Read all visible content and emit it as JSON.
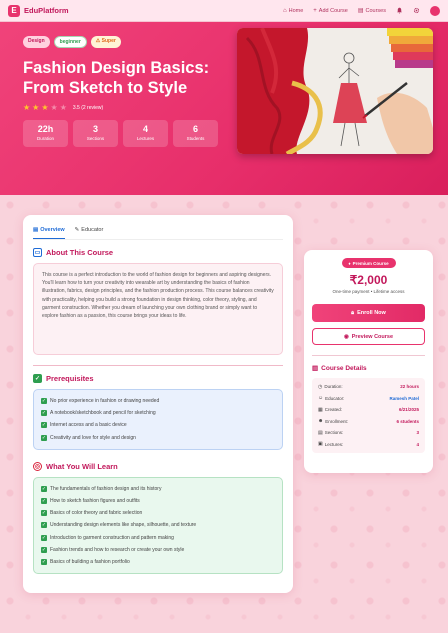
{
  "nav": {
    "brand": "EduPlatform",
    "links": [
      {
        "icon": "home-icon",
        "glyph": "⌂",
        "label": "Home"
      },
      {
        "icon": "plus-icon",
        "glyph": "+",
        "label": "Add Course"
      },
      {
        "icon": "book-icon",
        "glyph": "▤",
        "label": "Courses"
      }
    ],
    "bell_icon": "bell-icon",
    "settings_icon": "gear-icon"
  },
  "hero": {
    "tags": [
      "Design",
      "beginner",
      "Super"
    ],
    "title": "Fashion Design Basics: From Sketch to Style",
    "rating_value": 3,
    "rating_max": 5,
    "rating_text": "3.5 (2 review)",
    "stats": [
      {
        "value": "22h",
        "label": "Duration"
      },
      {
        "value": "3",
        "label": "Sections"
      },
      {
        "value": "4",
        "label": "Lectures"
      },
      {
        "value": "6",
        "label": "Students"
      }
    ]
  },
  "tabs": [
    "Overview",
    "Educator"
  ],
  "about": {
    "heading": "About This Course",
    "text": "This course is a perfect introduction to the world of fashion design for beginners and aspiring designers. You'll learn how to turn your creativity into wearable art by understanding the basics of fashion illustration, fabrics, design principles, and the fashion production process. This course balances creativity with practicality, helping you build a strong foundation in design thinking, color theory, styling, and garment construction. Whether you dream of launching your own clothing brand or simply want to explore fashion as a passion, this course brings your ideas to life."
  },
  "prerequisites": {
    "heading": "Prerequisites",
    "items": [
      "No prior experience in fashion or drawing needed",
      "A notebook/sketchbook and pencil for sketching",
      "Internet access and a basic device",
      "Creativity and love for style and design"
    ]
  },
  "learn": {
    "heading": "What You Will Learn",
    "items": [
      "The fundamentals of fashion design and its history",
      "How to sketch fashion figures and outfits",
      "Basics of color theory and fabric selection",
      "Understanding design elements like shape, silhouette, and texture",
      "Introduction to garment construction and pattern making",
      "Fashion trends and how to research or create your own style",
      "Basics of building a fashion portfolio"
    ]
  },
  "sidebar": {
    "badge": "Premium Course",
    "price": "₹2,000",
    "price_sub": "One-time payment • Lifetime access",
    "enroll_label": "Enroll Now",
    "preview_label": "Preview Course",
    "details_heading": "Course Details",
    "details": [
      {
        "icon": "clock-icon",
        "glyph": "◷",
        "label": "Duration:",
        "value": "22 hours"
      },
      {
        "icon": "user-icon",
        "glyph": "☺",
        "label": "Educator:",
        "value": "Ramesh Patel"
      },
      {
        "icon": "calendar-icon",
        "glyph": "▦",
        "label": "Created:",
        "value": "6/21/2025"
      },
      {
        "icon": "students-icon",
        "glyph": "☻",
        "label": "Enrollment:",
        "value": "6 students"
      },
      {
        "icon": "sections-icon",
        "glyph": "▤",
        "label": "Sections:",
        "value": "3"
      },
      {
        "icon": "lectures-icon",
        "glyph": "▣",
        "label": "Lectures:",
        "value": "4"
      }
    ]
  },
  "colors": {
    "accent": "#e8336d",
    "hero_start": "#f0437a",
    "hero_end": "#d91f5c",
    "background": "#f9d3dc",
    "link_blue": "#1e6bd6",
    "check_green": "#2e9e4f"
  }
}
